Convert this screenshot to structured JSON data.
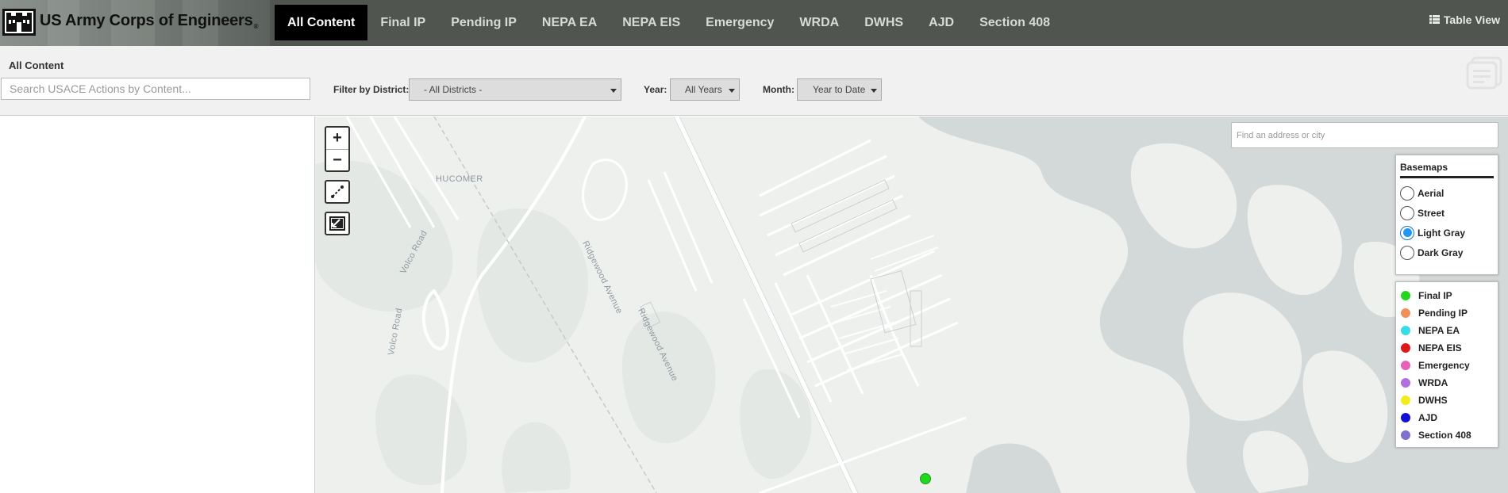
{
  "header": {
    "brand_title": "US Army Corps of Engineers",
    "brand_reg": "®",
    "table_view_label": "Table View",
    "nav": [
      {
        "label": "All Content",
        "active": true
      },
      {
        "label": "Final IP"
      },
      {
        "label": "Pending IP"
      },
      {
        "label": "NEPA EA"
      },
      {
        "label": "NEPA EIS"
      },
      {
        "label": "Emergency"
      },
      {
        "label": "WRDA"
      },
      {
        "label": "DWHS"
      },
      {
        "label": "AJD"
      },
      {
        "label": "Section 408"
      }
    ]
  },
  "filters": {
    "section_title": "All Content",
    "search_placeholder": "Search USACE Actions by Content...",
    "district_label": "Filter by District:",
    "district_value": "- All Districts -",
    "year_label": "Year:",
    "year_value": "All Years",
    "month_label": "Month:",
    "month_value": "Year to Date"
  },
  "map": {
    "zoom_in": "+",
    "zoom_out": "−",
    "address_placeholder": "Find an address or city",
    "labels": {
      "place": "HUCOMER",
      "road1": "Ridgewood Avenue",
      "road2": "Ridgewood Avenue",
      "road3": "Volco Road",
      "road4": "Volco Road"
    },
    "basemaps": {
      "title": "Basemaps",
      "options": [
        {
          "label": "Aerial",
          "checked": false
        },
        {
          "label": "Street",
          "checked": false
        },
        {
          "label": "Light Gray",
          "checked": true
        },
        {
          "label": "Dark Gray",
          "checked": false
        }
      ]
    },
    "legend": [
      {
        "label": "Final IP",
        "color": "#22d81e"
      },
      {
        "label": "Pending IP",
        "color": "#f0905a"
      },
      {
        "label": "NEPA EA",
        "color": "#38dce8"
      },
      {
        "label": "NEPA EIS",
        "color": "#e01818"
      },
      {
        "label": "Emergency",
        "color": "#e860b8"
      },
      {
        "label": "WRDA",
        "color": "#b070e0"
      },
      {
        "label": "DWHS",
        "color": "#f2ec1a"
      },
      {
        "label": "AJD",
        "color": "#1010d8"
      },
      {
        "label": "Section 408",
        "color": "#8070d0"
      }
    ]
  }
}
